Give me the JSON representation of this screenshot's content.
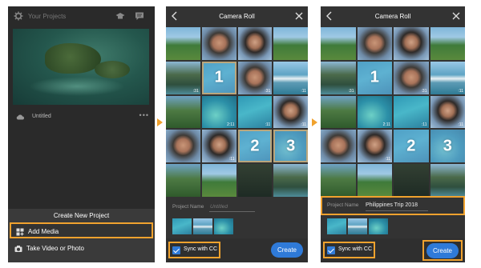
{
  "screen1": {
    "header_title": "Your Projects",
    "project_name": "Untitled",
    "more": "•••",
    "sheet_title": "Create New Project",
    "add_media": "Add Media",
    "take_video": "Take Video or Photo"
  },
  "screen2": {
    "title": "Camera Roll",
    "durations": [
      ":31",
      ":31",
      ":11",
      "2:11",
      ":11",
      ":11",
      ":11"
    ],
    "selection_numbers": [
      "1",
      "2",
      "3"
    ],
    "project_name_label": "Project Name",
    "project_name_placeholder": "Untitled",
    "sync_label": "Sync with CC",
    "create_label": "Create"
  },
  "screen3": {
    "title": "Camera Roll",
    "durations": [
      ":31",
      ":31",
      ":11",
      "2:11",
      ":11",
      ":11",
      ":11"
    ],
    "selection_numbers": [
      "1",
      "2",
      "3"
    ],
    "project_name_label": "Project Name",
    "project_name_value": "Philippines Trip 2018",
    "sync_label": "Sync with CC",
    "create_label": "Create"
  },
  "colors": {
    "highlight": "#f0a22e",
    "accent_blue": "#2f7ad8",
    "panel_dark": "#2a2a2a"
  }
}
